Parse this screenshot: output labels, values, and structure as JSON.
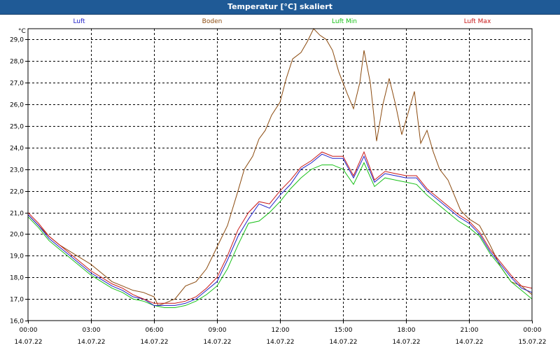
{
  "window": {
    "title": "Temperatur [°C] skaliert"
  },
  "chart_data": {
    "type": "line",
    "title": "Temperatur [°C] skaliert",
    "ylabel": "°C",
    "ylim": [
      16.0,
      29.0
    ],
    "yticks": [
      "16,0",
      "17,0",
      "18,0",
      "19,0",
      "20,0",
      "21,0",
      "22,0",
      "23,0",
      "24,0",
      "25,0",
      "26,0",
      "27,0",
      "28,0",
      "29,0"
    ],
    "xlim": [
      0,
      24
    ],
    "xticks": [
      {
        "time": "00:00",
        "date": "14.07.22"
      },
      {
        "time": "03:00",
        "date": "14.07.22"
      },
      {
        "time": "06:00",
        "date": "14.07.22"
      },
      {
        "time": "09:00",
        "date": "14.07.22"
      },
      {
        "time": "12:00",
        "date": "14.07.22"
      },
      {
        "time": "15:00",
        "date": "14.07.22"
      },
      {
        "time": "18:00",
        "date": "14.07.22"
      },
      {
        "time": "21:00",
        "date": "14.07.22"
      },
      {
        "time": "00:00",
        "date": "15.07.22"
      }
    ],
    "grid": true,
    "legend": "top",
    "series": [
      {
        "name": "Luft",
        "color": "#2020c8",
        "points": [
          [
            0,
            20.9
          ],
          [
            0.5,
            20.4
          ],
          [
            1,
            19.8
          ],
          [
            1.5,
            19.4
          ],
          [
            2,
            19.0
          ],
          [
            2.5,
            18.6
          ],
          [
            3,
            18.2
          ],
          [
            3.5,
            17.9
          ],
          [
            4,
            17.6
          ],
          [
            4.5,
            17.4
          ],
          [
            5,
            17.1
          ],
          [
            5.5,
            17.0
          ],
          [
            6,
            16.7
          ],
          [
            6.5,
            16.7
          ],
          [
            7,
            16.7
          ],
          [
            7.5,
            16.8
          ],
          [
            8,
            17.0
          ],
          [
            8.5,
            17.4
          ],
          [
            9,
            17.8
          ],
          [
            9.5,
            18.8
          ],
          [
            10,
            19.9
          ],
          [
            10.5,
            20.7
          ],
          [
            11,
            21.4
          ],
          [
            11.5,
            21.2
          ],
          [
            12,
            21.8
          ],
          [
            12.5,
            22.3
          ],
          [
            13,
            23.0
          ],
          [
            13.5,
            23.3
          ],
          [
            14,
            23.7
          ],
          [
            14.5,
            23.5
          ],
          [
            15,
            23.5
          ],
          [
            15.5,
            22.6
          ],
          [
            16,
            23.6
          ],
          [
            16.5,
            22.4
          ],
          [
            17,
            22.8
          ],
          [
            17.5,
            22.7
          ],
          [
            18,
            22.6
          ],
          [
            18.5,
            22.6
          ],
          [
            19,
            22.0
          ],
          [
            19.5,
            21.6
          ],
          [
            20,
            21.2
          ],
          [
            20.5,
            20.8
          ],
          [
            21,
            20.5
          ],
          [
            21.5,
            20.0
          ],
          [
            22,
            19.2
          ],
          [
            22.5,
            18.6
          ],
          [
            23,
            18.0
          ],
          [
            23.5,
            17.5
          ],
          [
            24,
            17.3
          ]
        ]
      },
      {
        "name": "Boden",
        "color": "#8b4a0e",
        "points": [
          [
            0,
            20.9
          ],
          [
            0.5,
            20.4
          ],
          [
            1,
            19.9
          ],
          [
            1.5,
            19.5
          ],
          [
            2,
            19.2
          ],
          [
            2.5,
            18.9
          ],
          [
            3,
            18.6
          ],
          [
            3.5,
            18.2
          ],
          [
            4,
            17.8
          ],
          [
            4.5,
            17.6
          ],
          [
            5,
            17.4
          ],
          [
            5.5,
            17.3
          ],
          [
            6,
            17.1
          ],
          [
            6.2,
            16.7
          ],
          [
            6.5,
            16.8
          ],
          [
            7,
            17.0
          ],
          [
            7.5,
            17.6
          ],
          [
            8,
            17.8
          ],
          [
            8.5,
            18.4
          ],
          [
            9,
            19.4
          ],
          [
            9.5,
            20.4
          ],
          [
            10,
            22.0
          ],
          [
            10.3,
            23.0
          ],
          [
            10.7,
            23.6
          ],
          [
            11,
            24.4
          ],
          [
            11.3,
            24.8
          ],
          [
            11.6,
            25.5
          ],
          [
            12,
            26.1
          ],
          [
            12.3,
            27.2
          ],
          [
            12.6,
            28.1
          ],
          [
            13,
            28.4
          ],
          [
            13.3,
            28.9
          ],
          [
            13.6,
            29.5
          ],
          [
            13.9,
            29.2
          ],
          [
            14.2,
            29.0
          ],
          [
            14.5,
            28.5
          ],
          [
            14.8,
            27.5
          ],
          [
            15.2,
            26.5
          ],
          [
            15.5,
            25.8
          ],
          [
            15.8,
            27.0
          ],
          [
            16,
            28.5
          ],
          [
            16.3,
            27.0
          ],
          [
            16.6,
            24.3
          ],
          [
            16.9,
            26.0
          ],
          [
            17.2,
            27.2
          ],
          [
            17.5,
            26.0
          ],
          [
            17.8,
            24.6
          ],
          [
            18.1,
            25.6
          ],
          [
            18.4,
            26.6
          ],
          [
            18.7,
            24.2
          ],
          [
            19,
            24.8
          ],
          [
            19.3,
            23.8
          ],
          [
            19.6,
            23.0
          ],
          [
            20,
            22.5
          ],
          [
            20.3,
            21.8
          ],
          [
            20.6,
            21.1
          ],
          [
            21,
            20.7
          ],
          [
            21.5,
            20.4
          ],
          [
            22,
            19.5
          ],
          [
            22.5,
            18.5
          ],
          [
            23,
            17.8
          ],
          [
            23.5,
            17.6
          ],
          [
            24,
            17.2
          ]
        ]
      },
      {
        "name": "Luft Min",
        "color": "#18c018",
        "points": [
          [
            0,
            20.8
          ],
          [
            0.5,
            20.3
          ],
          [
            1,
            19.7
          ],
          [
            1.5,
            19.3
          ],
          [
            2,
            18.9
          ],
          [
            2.5,
            18.5
          ],
          [
            3,
            18.1
          ],
          [
            3.5,
            17.8
          ],
          [
            4,
            17.5
          ],
          [
            4.5,
            17.3
          ],
          [
            5,
            17.0
          ],
          [
            5.5,
            16.9
          ],
          [
            6,
            16.7
          ],
          [
            6.5,
            16.6
          ],
          [
            7,
            16.6
          ],
          [
            7.5,
            16.7
          ],
          [
            8,
            16.9
          ],
          [
            8.5,
            17.2
          ],
          [
            9,
            17.6
          ],
          [
            9.5,
            18.4
          ],
          [
            10,
            19.5
          ],
          [
            10.5,
            20.5
          ],
          [
            11,
            20.6
          ],
          [
            11.5,
            21.0
          ],
          [
            12,
            21.5
          ],
          [
            12.5,
            22.1
          ],
          [
            13,
            22.6
          ],
          [
            13.5,
            23.0
          ],
          [
            14,
            23.2
          ],
          [
            14.5,
            23.2
          ],
          [
            15,
            23.0
          ],
          [
            15.5,
            22.3
          ],
          [
            16,
            23.3
          ],
          [
            16.5,
            22.2
          ],
          [
            17,
            22.6
          ],
          [
            17.5,
            22.5
          ],
          [
            18,
            22.4
          ],
          [
            18.5,
            22.3
          ],
          [
            19,
            21.8
          ],
          [
            19.5,
            21.4
          ],
          [
            20,
            21.0
          ],
          [
            20.5,
            20.6
          ],
          [
            21,
            20.3
          ],
          [
            21.5,
            19.9
          ],
          [
            22,
            19.1
          ],
          [
            22.5,
            18.5
          ],
          [
            23,
            17.8
          ],
          [
            23.5,
            17.4
          ],
          [
            24,
            17.0
          ]
        ]
      },
      {
        "name": "Luft Max",
        "color": "#c81818",
        "points": [
          [
            0,
            21.0
          ],
          [
            0.5,
            20.5
          ],
          [
            1,
            19.9
          ],
          [
            1.5,
            19.5
          ],
          [
            2,
            19.1
          ],
          [
            2.5,
            18.7
          ],
          [
            3,
            18.3
          ],
          [
            3.5,
            18.0
          ],
          [
            4,
            17.7
          ],
          [
            4.5,
            17.5
          ],
          [
            5,
            17.2
          ],
          [
            5.5,
            17.0
          ],
          [
            6,
            16.8
          ],
          [
            6.5,
            16.8
          ],
          [
            7,
            16.8
          ],
          [
            7.5,
            16.9
          ],
          [
            8,
            17.1
          ],
          [
            8.5,
            17.5
          ],
          [
            9,
            18.0
          ],
          [
            9.5,
            19.0
          ],
          [
            10,
            20.2
          ],
          [
            10.5,
            21.0
          ],
          [
            11,
            21.5
          ],
          [
            11.5,
            21.4
          ],
          [
            12,
            22.0
          ],
          [
            12.5,
            22.5
          ],
          [
            13,
            23.1
          ],
          [
            13.5,
            23.4
          ],
          [
            14,
            23.8
          ],
          [
            14.5,
            23.6
          ],
          [
            15,
            23.6
          ],
          [
            15.5,
            22.7
          ],
          [
            16,
            23.8
          ],
          [
            16.5,
            22.5
          ],
          [
            17,
            22.9
          ],
          [
            17.5,
            22.8
          ],
          [
            18,
            22.7
          ],
          [
            18.5,
            22.7
          ],
          [
            19,
            22.1
          ],
          [
            19.5,
            21.7
          ],
          [
            20,
            21.3
          ],
          [
            20.5,
            20.9
          ],
          [
            21,
            20.6
          ],
          [
            21.5,
            20.1
          ],
          [
            22,
            19.3
          ],
          [
            22.5,
            18.7
          ],
          [
            23,
            18.1
          ],
          [
            23.5,
            17.6
          ],
          [
            24,
            17.5
          ]
        ]
      }
    ]
  }
}
